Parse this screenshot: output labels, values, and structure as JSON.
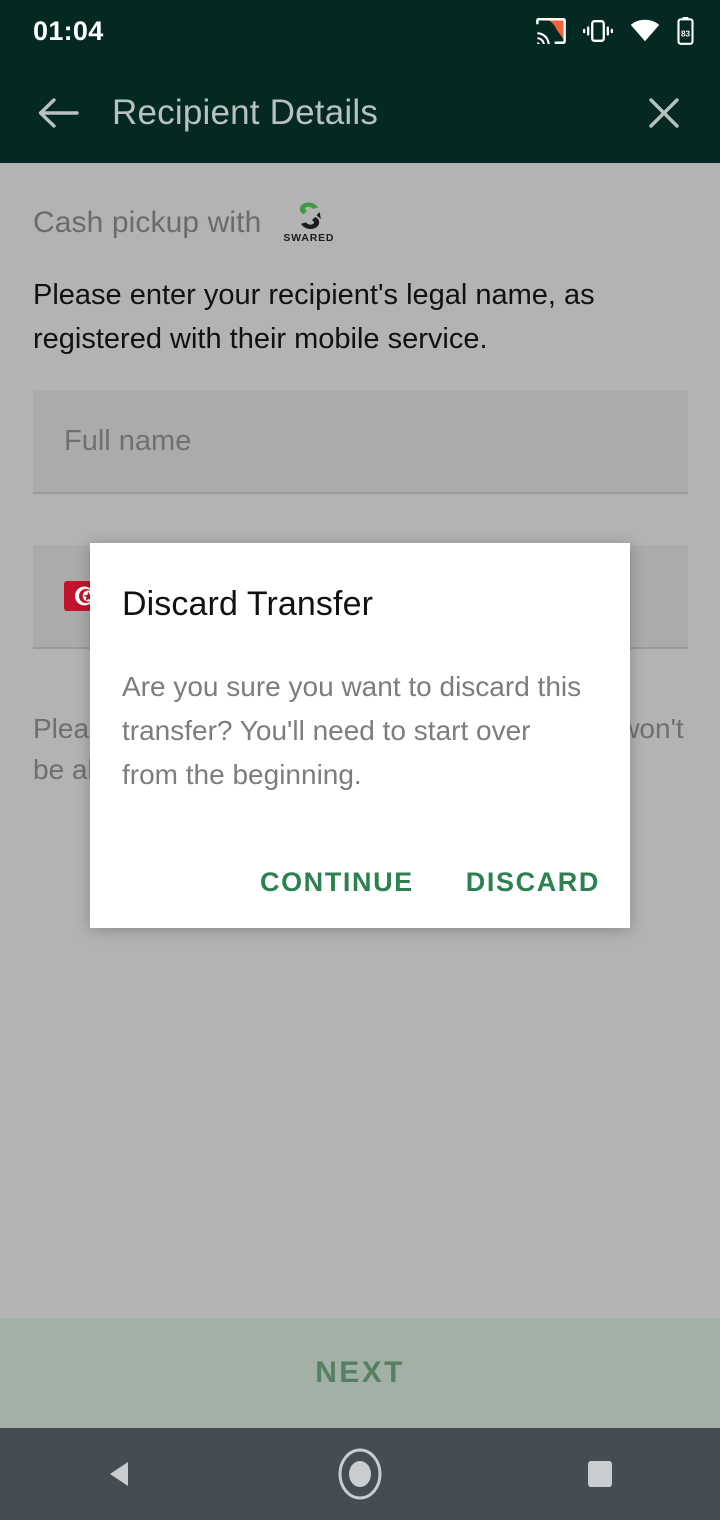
{
  "status_bar": {
    "time": "01:04",
    "battery_level": "83",
    "icons": [
      "cast-icon",
      "vibrate-icon",
      "wifi-icon",
      "battery-icon"
    ],
    "background_color": "#032922",
    "cast_accent_color": "#f0653a"
  },
  "app_bar": {
    "back_icon": "back-arrow-icon",
    "title": "Recipient Details",
    "close_icon": "close-icon",
    "background_color": "#032922",
    "title_color": "#b9c2bf"
  },
  "content": {
    "provider_label": "Cash pickup with",
    "provider_logo_name": "SWARED",
    "provider_logo_colors": {
      "top": "#3f9b43",
      "bottom": "#1c1c1c"
    },
    "intro_text": "Please enter your recipient's legal name, as registered with their mobile service.",
    "fields": [
      {
        "name": "full-name-field",
        "placeholder": "Full name",
        "value": ""
      },
      {
        "name": "phone-number-field",
        "flag": "tunisia-flag",
        "placeholder": "",
        "value": ""
      }
    ],
    "helper_text": "Please make sure the details are correct. They won't be able to collect the money if they don't match."
  },
  "bottom_bar": {
    "next_label": "NEXT",
    "background_color": "#a3b0a5",
    "text_color": "#558062"
  },
  "dialog": {
    "title": "Discard Transfer",
    "message": "Are you sure you want to discard this transfer? You'll need to start over from the beginning.",
    "buttons": [
      {
        "name": "continue-button",
        "label": "CONTINUE"
      },
      {
        "name": "discard-button",
        "label": "DISCARD"
      }
    ],
    "accent_color": "#2d8050",
    "background_color": "#ffffff"
  },
  "nav_bar": {
    "background_color": "#454c52",
    "buttons": [
      "back-nav-button",
      "home-nav-button",
      "recents-nav-button"
    ]
  }
}
